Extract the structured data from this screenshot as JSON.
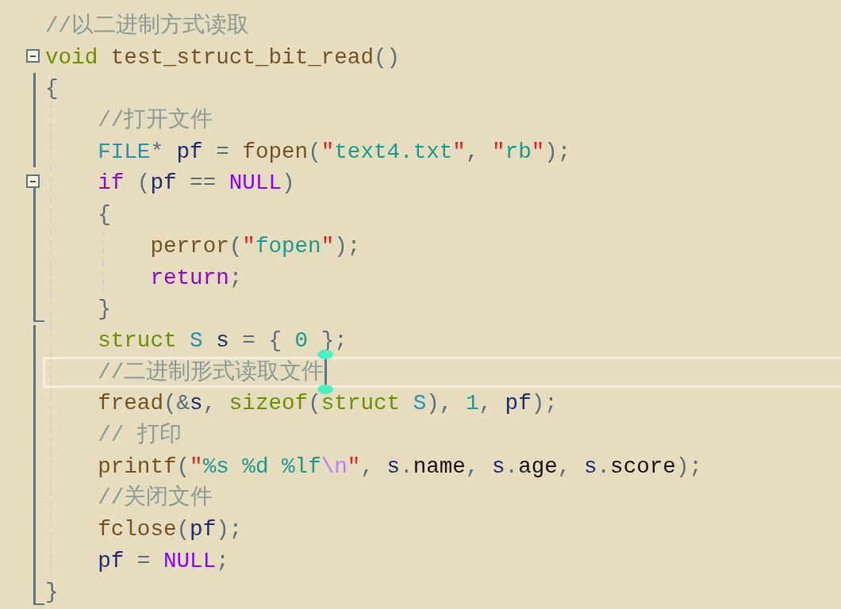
{
  "lines": [
    {
      "tokens": [
        {
          "kind": "comment",
          "text": "//以二进制方式读取"
        }
      ]
    },
    {
      "fold": true,
      "tokens": [
        {
          "kind": "keyword",
          "text": "void"
        },
        {
          "kind": "func",
          "text": " test_struct_bit_read"
        },
        {
          "kind": "punct",
          "text": "()"
        }
      ]
    },
    {
      "tokens": [
        {
          "kind": "punct",
          "text": "{"
        }
      ],
      "children": [
        {
          "tokens": [
            {
              "kind": "comment",
              "text": "//打开文件"
            }
          ]
        },
        {
          "tokens": [
            {
              "kind": "type",
              "text": "FILE"
            },
            {
              "kind": "punct",
              "text": "* "
            },
            {
              "kind": "ident",
              "text": "pf"
            },
            {
              "kind": "punct",
              "text": " = "
            },
            {
              "kind": "func",
              "text": "fopen"
            },
            {
              "kind": "punct",
              "text": "("
            },
            {
              "kind": "quote",
              "text": "\""
            },
            {
              "kind": "string",
              "text": "text4.txt"
            },
            {
              "kind": "quote",
              "text": "\""
            },
            {
              "kind": "punct",
              "text": ", "
            },
            {
              "kind": "quote",
              "text": "\""
            },
            {
              "kind": "string",
              "text": "rb"
            },
            {
              "kind": "quote",
              "text": "\""
            },
            {
              "kind": "punct",
              "text": ");"
            }
          ]
        },
        {
          "fold": true,
          "tokens": [
            {
              "kind": "control",
              "text": "if"
            },
            {
              "kind": "punct",
              "text": " ("
            },
            {
              "kind": "ident",
              "text": "pf"
            },
            {
              "kind": "punct",
              "text": " == "
            },
            {
              "kind": "macro",
              "text": "NULL"
            },
            {
              "kind": "punct",
              "text": ")"
            }
          ]
        },
        {
          "tokens": [
            {
              "kind": "punct",
              "text": "{"
            }
          ],
          "children": [
            {
              "tokens": [
                {
                  "kind": "func",
                  "text": "perror"
                },
                {
                  "kind": "punct",
                  "text": "("
                },
                {
                  "kind": "quote",
                  "text": "\""
                },
                {
                  "kind": "string",
                  "text": "fopen"
                },
                {
                  "kind": "quote",
                  "text": "\""
                },
                {
                  "kind": "punct",
                  "text": ");"
                }
              ]
            },
            {
              "tokens": [
                {
                  "kind": "control",
                  "text": "return"
                },
                {
                  "kind": "punct",
                  "text": ";"
                }
              ]
            }
          ]
        },
        {
          "tokens": [
            {
              "kind": "punct",
              "text": "}"
            }
          ]
        },
        {
          "tokens": [
            {
              "kind": "keyword",
              "text": "struct"
            },
            {
              "kind": "type",
              "text": " S"
            },
            {
              "kind": "ident",
              "text": " s"
            },
            {
              "kind": "punct",
              "text": " = { "
            },
            {
              "kind": "number",
              "text": "0"
            },
            {
              "kind": "punct",
              "text": " };"
            }
          ]
        },
        {
          "current": true,
          "tokens": [
            {
              "kind": "comment",
              "text": "//二进制形式读取文件"
            }
          ]
        },
        {
          "tokens": [
            {
              "kind": "func",
              "text": "fread"
            },
            {
              "kind": "punct",
              "text": "(&"
            },
            {
              "kind": "ident",
              "text": "s"
            },
            {
              "kind": "punct",
              "text": ", "
            },
            {
              "kind": "keyword",
              "text": "sizeof"
            },
            {
              "kind": "punct",
              "text": "("
            },
            {
              "kind": "keyword",
              "text": "struct"
            },
            {
              "kind": "type",
              "text": " S"
            },
            {
              "kind": "punct",
              "text": "), "
            },
            {
              "kind": "number",
              "text": "1"
            },
            {
              "kind": "punct",
              "text": ", "
            },
            {
              "kind": "ident",
              "text": "pf"
            },
            {
              "kind": "punct",
              "text": ");"
            }
          ]
        },
        {
          "tokens": [
            {
              "kind": "comment",
              "text": "// 打印"
            }
          ]
        },
        {
          "tokens": [
            {
              "kind": "func",
              "text": "printf"
            },
            {
              "kind": "punct",
              "text": "("
            },
            {
              "kind": "quote",
              "text": "\""
            },
            {
              "kind": "string",
              "text": "%s %d %lf"
            },
            {
              "kind": "escape",
              "text": "\\n"
            },
            {
              "kind": "quote",
              "text": "\""
            },
            {
              "kind": "punct",
              "text": ", "
            },
            {
              "kind": "ident",
              "text": "s"
            },
            {
              "kind": "punct",
              "text": "."
            },
            {
              "kind": "member",
              "text": "name"
            },
            {
              "kind": "punct",
              "text": ", "
            },
            {
              "kind": "ident",
              "text": "s"
            },
            {
              "kind": "punct",
              "text": "."
            },
            {
              "kind": "member",
              "text": "age"
            },
            {
              "kind": "punct",
              "text": ", "
            },
            {
              "kind": "ident",
              "text": "s"
            },
            {
              "kind": "punct",
              "text": "."
            },
            {
              "kind": "member",
              "text": "score"
            },
            {
              "kind": "punct",
              "text": ");"
            }
          ]
        },
        {
          "tokens": [
            {
              "kind": "comment",
              "text": "//关闭文件"
            }
          ]
        },
        {
          "tokens": [
            {
              "kind": "func",
              "text": "fclose"
            },
            {
              "kind": "punct",
              "text": "("
            },
            {
              "kind": "ident",
              "text": "pf"
            },
            {
              "kind": "punct",
              "text": ");"
            }
          ]
        },
        {
          "tokens": [
            {
              "kind": "ident",
              "text": "pf"
            },
            {
              "kind": "punct",
              "text": " = "
            },
            {
              "kind": "macro",
              "text": "NULL"
            },
            {
              "kind": "punct",
              "text": ";"
            }
          ]
        }
      ]
    },
    {
      "tokens": [
        {
          "kind": "punct",
          "text": "}"
        }
      ]
    }
  ]
}
